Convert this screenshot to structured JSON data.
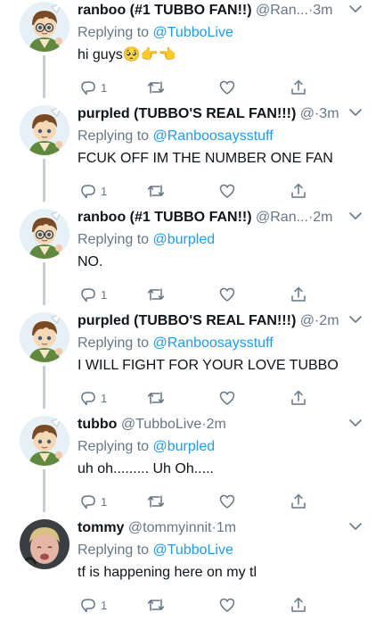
{
  "thread": {
    "tweets": [
      {
        "name": "ranboo (#1 TUBBO FAN!!)",
        "handle": "@Ran...",
        "time": "3m",
        "replying_prefix": "Replying to ",
        "replying_to": "@TubboLive",
        "text": "hi guys🥺👉👈",
        "reply_count": "1",
        "avatar_icon": "cartoon-avatar-icon"
      },
      {
        "name": "purpled (TUBBO'S REAL FAN!!!)",
        "handle": "@",
        "time": "3m",
        "replying_prefix": "Replying to ",
        "replying_to": "@Ranboosaysstuff",
        "text": "FCUK OFF IM THE NUMBER ONE FAN",
        "reply_count": "1",
        "avatar_icon": "cartoon-avatar-icon"
      },
      {
        "name": "ranboo (#1 TUBBO FAN!!)",
        "handle": "@Ran...",
        "time": "2m",
        "replying_prefix": "Replying to ",
        "replying_to": "@burpled",
        "text": "NO.",
        "reply_count": "1",
        "avatar_icon": "cartoon-avatar-icon"
      },
      {
        "name": "purpled (TUBBO'S REAL FAN!!!)",
        "handle": "@",
        "time": "2m",
        "replying_prefix": "Replying to ",
        "replying_to": "@Ranboosaysstuff",
        "text": "I WILL FIGHT FOR YOUR LOVE TUBBO",
        "reply_count": "1",
        "avatar_icon": "cartoon-avatar-icon"
      },
      {
        "name": "tubbo",
        "handle": "@TubboLive",
        "time": "2m",
        "replying_prefix": "Replying to ",
        "replying_to": "@burpled",
        "text": "uh oh......... Uh Oh.....",
        "reply_count": "1",
        "avatar_icon": "cartoon-avatar-icon"
      },
      {
        "name": "tommy",
        "handle": "@tommyinnit",
        "time": "1m",
        "replying_prefix": "Replying to ",
        "replying_to": "@TubboLive",
        "text": "tf is happening here on my tl",
        "reply_count": "1",
        "avatar_icon": "photo-avatar-icon"
      }
    ]
  },
  "time_separator": " · ",
  "colors": {
    "secondary_text": "#657786",
    "link": "#1d9bf0",
    "thread_line": "#c4cfd6"
  }
}
